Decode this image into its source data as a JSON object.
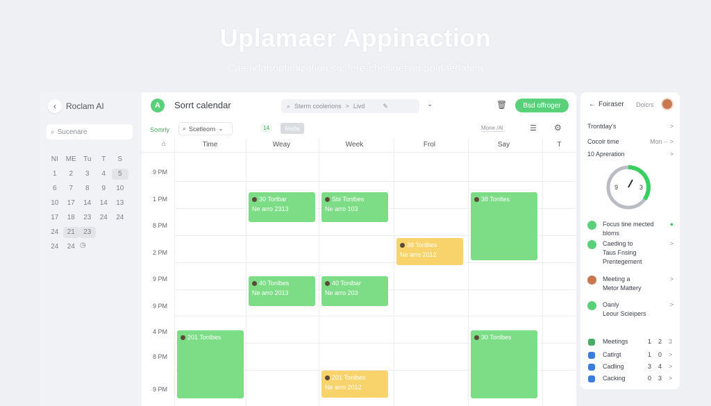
{
  "hero": {
    "title": "Uplamaer Appinaction",
    "subtitle": "Calendar optimization susfere-chelligeting apidaedatina"
  },
  "sidebar": {
    "brand": "Roclam AI",
    "search_placeholder": "Sucenare",
    "mini_calendar": {
      "rows": [
        [
          "NI",
          "ME",
          "Tu",
          "T",
          "S"
        ],
        [
          "1",
          "2",
          "3",
          "4",
          "5"
        ],
        [
          "6",
          "7",
          "8",
          "9",
          "10"
        ],
        [
          "10",
          "17",
          "14",
          "14",
          "13"
        ],
        [
          "17",
          "18",
          "23",
          "24",
          "24"
        ],
        [
          "24",
          "21",
          "23",
          "",
          ""
        ],
        [
          "24",
          "24",
          "",
          "",
          ""
        ]
      ]
    }
  },
  "main": {
    "title": "Sorrt calendar",
    "logo_letter": "A",
    "search": {
      "part1": "Sterm coolerions",
      "sep": ">",
      "part2": "Livd"
    },
    "primary_button": "Bsd offroger",
    "toolbar": {
      "label": "Somrly",
      "select": "Scetleorn",
      "chip1": "14",
      "chip2": "Redla",
      "right_field": "Mone /Al"
    },
    "columns": [
      "Time",
      "Weay",
      "Week",
      "Frol",
      "Say",
      "T"
    ],
    "times": [
      "9 PM",
      "1 PM",
      "8 PM",
      "2 PM",
      "9 PM",
      "9 PM",
      "4 PM",
      "8 PM",
      "9 PM"
    ],
    "events": [
      {
        "col": 1,
        "row_start": 1.0,
        "row_end": 1.55,
        "color": "green",
        "title": "30 Torlbar",
        "sub": "Ne arro 2313"
      },
      {
        "col": 2,
        "row_start": 1.0,
        "row_end": 1.55,
        "color": "green",
        "title": "Sbl Tonlbes",
        "sub": "Ne arro 103"
      },
      {
        "col": 4,
        "row_start": 1.0,
        "row_end": 2.25,
        "color": "green",
        "title": "38 Tonltes",
        "sub": ""
      },
      {
        "col": 3,
        "row_start": 1.85,
        "row_end": 2.35,
        "color": "yellow",
        "title": "38 Tonlbes",
        "sub": "Ne arro 2012"
      },
      {
        "col": 1,
        "row_start": 2.55,
        "row_end": 3.1,
        "color": "green",
        "title": "40 Tonlbes",
        "sub": "Ne arro 2013"
      },
      {
        "col": 2,
        "row_start": 2.55,
        "row_end": 3.1,
        "color": "green",
        "title": "40 Tonlbar",
        "sub": "Ne arro 203"
      },
      {
        "col": 0,
        "row_start": 3.55,
        "row_end": 4.8,
        "color": "green",
        "title": "201 Tonlbes",
        "sub": ""
      },
      {
        "col": 4,
        "row_start": 3.55,
        "row_end": 4.8,
        "color": "green",
        "title": "30 Tonlbes",
        "sub": ""
      },
      {
        "col": 2,
        "row_start": 4.3,
        "row_end": 4.8,
        "color": "yellow",
        "title": "201 Tonlbes",
        "sub": "Ne arro 2012"
      }
    ]
  },
  "right_panel": {
    "header": {
      "title": "Foiraser",
      "link": "Doicrs"
    },
    "lines": [
      {
        "label": "Trontday's",
        "right": ">"
      },
      {
        "label": "Cocolr time",
        "right": "Mon ·· >"
      },
      {
        "label": "10 Apreration",
        "right": ">"
      }
    ],
    "gauge": {
      "left": "9",
      "right": "3",
      "fraction": 0.35
    },
    "items": [
      {
        "icon": "check-icon",
        "color": "#5bd07a",
        "lines": [
          "Focus tine mected",
          "bloms"
        ],
        "right": "●"
      },
      {
        "icon": "clock-icon",
        "color": "#5bd07a",
        "lines": [
          "Caeding to",
          "Taus Fnsing",
          "Prentegement"
        ],
        "right": ">"
      },
      {
        "icon": "avatar-icon",
        "color": "#c9774f",
        "lines": [
          "Meeting a",
          "Metor Mattery"
        ],
        "right": ">"
      },
      {
        "icon": "circle-icon",
        "color": "#5bd07a",
        "lines": [
          "Oanly",
          "Leour Scieipers"
        ],
        "right": ">"
      }
    ],
    "stats": [
      {
        "label": "Meetings",
        "n1": "1",
        "n2": "2",
        "n3": "3",
        "color": "#4caa62"
      },
      {
        "label": "Catlrgt",
        "n1": "1",
        "n2": "0",
        "n3": ">",
        "color": "#3b7ddd"
      },
      {
        "label": "Cadling",
        "n1": "3",
        "n2": "4",
        "n3": ">",
        "color": "#3b7ddd"
      },
      {
        "label": "Cacking",
        "n1": "0",
        "n2": "3",
        "n3": ">",
        "color": "#3b7ddd"
      }
    ]
  }
}
